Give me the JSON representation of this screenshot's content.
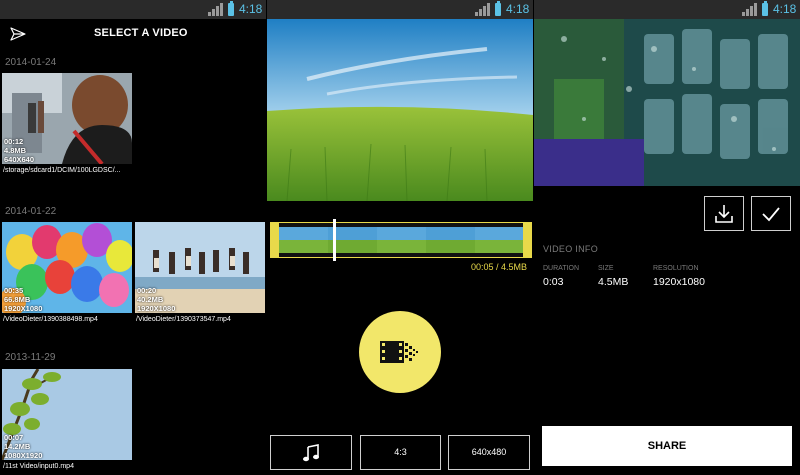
{
  "status_bar": {
    "time": "4:18"
  },
  "select_screen": {
    "title": "SELECT A VIDEO",
    "groups": [
      {
        "date": "2014-01-24",
        "videos": [
          {
            "duration": "00:12",
            "size": "4.8MB",
            "resolution": "640X640",
            "path": "/storage/sdcard1/DCIM/100LGDSC/..."
          }
        ]
      },
      {
        "date": "2014-01-22",
        "videos": [
          {
            "duration": "00:35",
            "size": "66.8MB",
            "resolution": "1920X1080",
            "path": "/VideoDieter/1390388498.mp4"
          },
          {
            "duration": "00:20",
            "size": "40.2MB",
            "resolution": "1920X1080",
            "path": "/VideoDieter/1390373547.mp4"
          }
        ]
      },
      {
        "date": "2013-11-29",
        "videos": [
          {
            "duration": "00:07",
            "size": "14.2MB",
            "resolution": "1080X1920",
            "path": "/11st Video/input0.mp4"
          }
        ]
      }
    ]
  },
  "edit_screen": {
    "timeline_info": "00:05 / 4.5MB",
    "trim_position": 0.22,
    "aspect_label": "4:3",
    "resolution_label": "640x480"
  },
  "result_screen": {
    "video_info_title": "VIDEO INFO",
    "duration_label": "DURATION",
    "duration_value": "0:03",
    "size_label": "SIZE",
    "size_value": "4.5MB",
    "resolution_label": "RESOLUTION",
    "resolution_value": "1920x1080",
    "share_label": "SHARE"
  },
  "colors": {
    "accent_yellow": "#f2e76a",
    "status_blue": "#5bc2e6",
    "background": "#000000"
  }
}
